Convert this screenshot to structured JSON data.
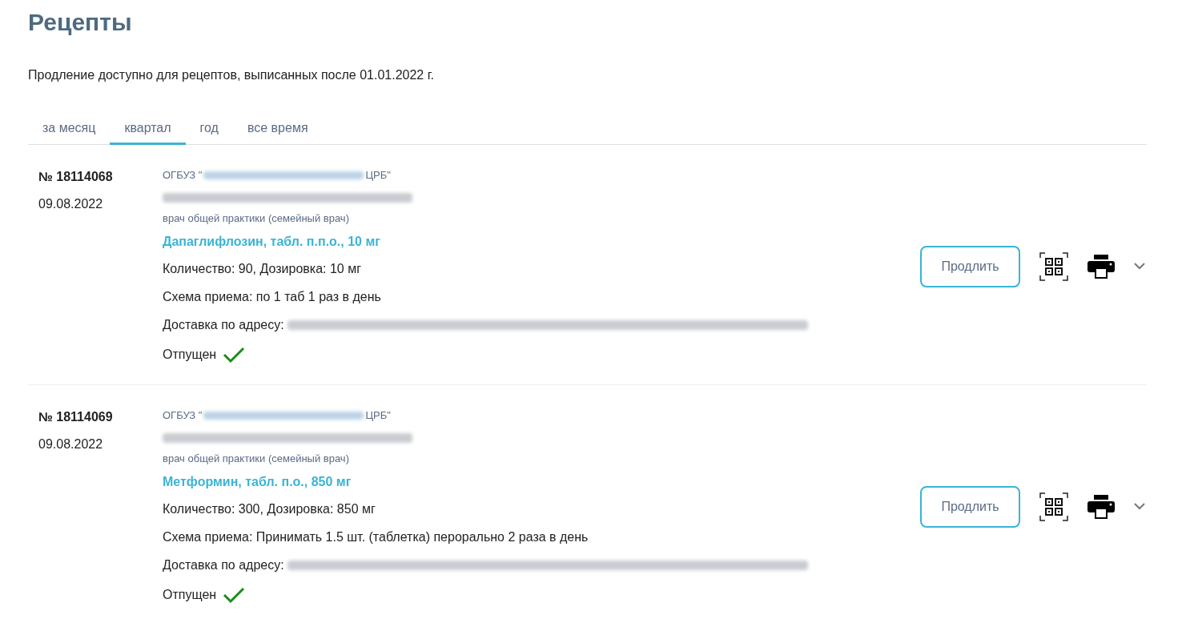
{
  "title": "Рецепты",
  "notice": "Продление доступно для рецептов, выписанных после 01.01.2022 г.",
  "tabs": [
    {
      "label": "за месяц",
      "selected": false
    },
    {
      "label": "квартал",
      "selected": true
    },
    {
      "label": "год",
      "selected": false
    },
    {
      "label": "все время",
      "selected": false
    }
  ],
  "prescriptions": [
    {
      "number": "№ 18114068",
      "date": "09.08.2022",
      "org_prefix": "ОГБУЗ \"",
      "org_suffix": "ЦРБ\"",
      "doctor_role": "врач общей практики (семейный врач)",
      "drug": "Дапаглифлозин, табл. п.п.о., 10 мг",
      "quantity": "Количество: 90, Дозировка: 10 мг",
      "scheme": "Схема приема: по 1 таб 1 раз в день",
      "delivery_label": "Доставка по адресу:",
      "status": "Отпущен",
      "dispensed": true,
      "button": "Продлить"
    },
    {
      "number": "№ 18114069",
      "date": "09.08.2022",
      "org_prefix": "ОГБУЗ \"",
      "org_suffix": "ЦРБ\"",
      "doctor_role": "врач общей практики (семейный врач)",
      "drug": "Метформин, табл. п.о., 850 мг",
      "quantity": "Количество: 300, Дозировка: 850 мг",
      "scheme": "Схема приема: Принимать 1.5 шт. (таблетка) перорально 2 раза в день",
      "delivery_label": "Доставка по адресу:",
      "status": "Отпущен",
      "dispensed": true,
      "button": "Продлить"
    }
  ]
}
